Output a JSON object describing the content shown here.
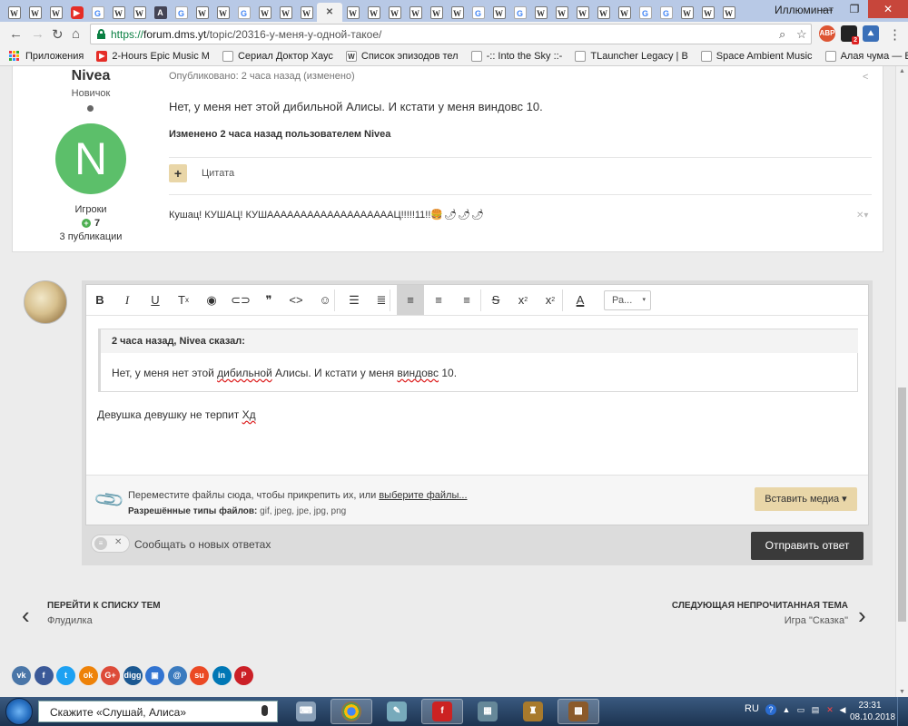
{
  "browser": {
    "tab_favicons": [
      "w",
      "w",
      "w",
      "yt",
      "g",
      "w",
      "w",
      "dark",
      "g",
      "w",
      "w",
      "g",
      "w",
      "w",
      "w",
      "x",
      "w",
      "w",
      "w",
      "w",
      "w",
      "w",
      "g",
      "w",
      "g",
      "w",
      "w",
      "w",
      "w",
      "w",
      "g",
      "g",
      "w",
      "w",
      "w"
    ],
    "user_label": "Иллюминат",
    "url_scheme": "https://",
    "url_host": "forum.dms.yt",
    "url_path": "/topic/20316-у-меня-у-одной-такое/",
    "extension_badge": "2",
    "abp_label": "ABP"
  },
  "bookmarks": {
    "apps_label": "Приложения",
    "items": [
      {
        "label": "2-Hours Epic Music M",
        "icon": "youtube-icon"
      },
      {
        "label": "Сериал Доктор Хаус",
        "icon": "page-icon"
      },
      {
        "label": "Список эпизодов тел",
        "icon": "wikipedia-icon"
      },
      {
        "label": "-:: Into the Sky ::-",
        "icon": "page-icon"
      },
      {
        "label": "TLauncher Legacy | В",
        "icon": "page-icon"
      },
      {
        "label": "Space Ambient Music",
        "icon": "page-icon"
      },
      {
        "label": "Алая чума — Википе",
        "icon": "page-icon"
      }
    ]
  },
  "post": {
    "author_name": "Nivea",
    "author_rank": "Новичок",
    "avatar_letter": "N",
    "avatar_color": "#5cbf6a",
    "author_group": "Игроки",
    "reputation": "7",
    "post_count": "3 публикации",
    "meta": "Опубликовано: 2 часа назад (изменено)",
    "text": "Нет, у меня нет этой дибильной Алисы. И кстати у меня виндовс 10.",
    "edited": "Изменено 2 часа назад пользователем Nivea",
    "quote_label": "Цитата",
    "signature_text": "Кушац! КУШАЦ! КУШАААААААААААААААААААЦ!!!!!11!!",
    "signature_emoji": "🍔🌶🌶🌶"
  },
  "editor": {
    "toolbar": [
      "B",
      "I",
      "U",
      "Tx",
      "eye",
      "link",
      "quote",
      "code",
      "emoji",
      "ul",
      "ol",
      "align-left",
      "align-center",
      "align-right",
      "strike",
      "sup",
      "sub",
      "color"
    ],
    "font_size_label": "Ра...",
    "quote_header": "2 часа назад, Nivea сказал:",
    "quote_before": "Нет, у меня нет этой ",
    "quote_spell1": "дибильной",
    "quote_middle": " Алисы. И кстати у меня ",
    "quote_spell2": "виндовс",
    "quote_after": " 10.",
    "reply_text": "Девушка девушку не терпит ",
    "reply_spell": "Хд",
    "attach_text": "Переместите файлы сюда, чтобы прикрепить их, или ",
    "attach_link": "выберите файлы...",
    "allowed_label": "Разрешённые типы файлов:",
    "allowed_types": " gif, jpeg, jpe, jpg, png",
    "media_button": "Вставить медиа ▾",
    "notify_label": "Сообщать о новых ответах",
    "submit_button": "Отправить ответ"
  },
  "topic_nav": {
    "prev_title": "ПЕРЕЙТИ К СПИСКУ ТЕМ",
    "prev_sub": "Флудилка",
    "next_title": "СЛЕДУЮЩАЯ НЕПРОЧИТАННАЯ ТЕМА",
    "next_sub": "Игра \"Сказка\""
  },
  "share_buttons": [
    {
      "name": "vk",
      "label": "vk",
      "color": "#4a76a8"
    },
    {
      "name": "facebook",
      "label": "f",
      "color": "#3b5998"
    },
    {
      "name": "twitter",
      "label": "t",
      "color": "#1da1f2"
    },
    {
      "name": "odnoklassniki",
      "label": "ok",
      "color": "#ee8208"
    },
    {
      "name": "google-plus",
      "label": "G+",
      "color": "#dd4b39"
    },
    {
      "name": "digg",
      "label": "digg",
      "color": "#1b5891"
    },
    {
      "name": "delicious",
      "label": "▣",
      "color": "#3274d1"
    },
    {
      "name": "email",
      "label": "@",
      "color": "#3b7bbf"
    },
    {
      "name": "stumbleupon",
      "label": "su",
      "color": "#eb4924"
    },
    {
      "name": "linkedin",
      "label": "in",
      "color": "#0077b5"
    },
    {
      "name": "pinterest",
      "label": "P",
      "color": "#cb2027"
    }
  ],
  "taskbar": {
    "search_text": "Скажите «Слушай, Алиса»",
    "language": "RU",
    "time": "23:31",
    "date": "08.10.2018"
  }
}
